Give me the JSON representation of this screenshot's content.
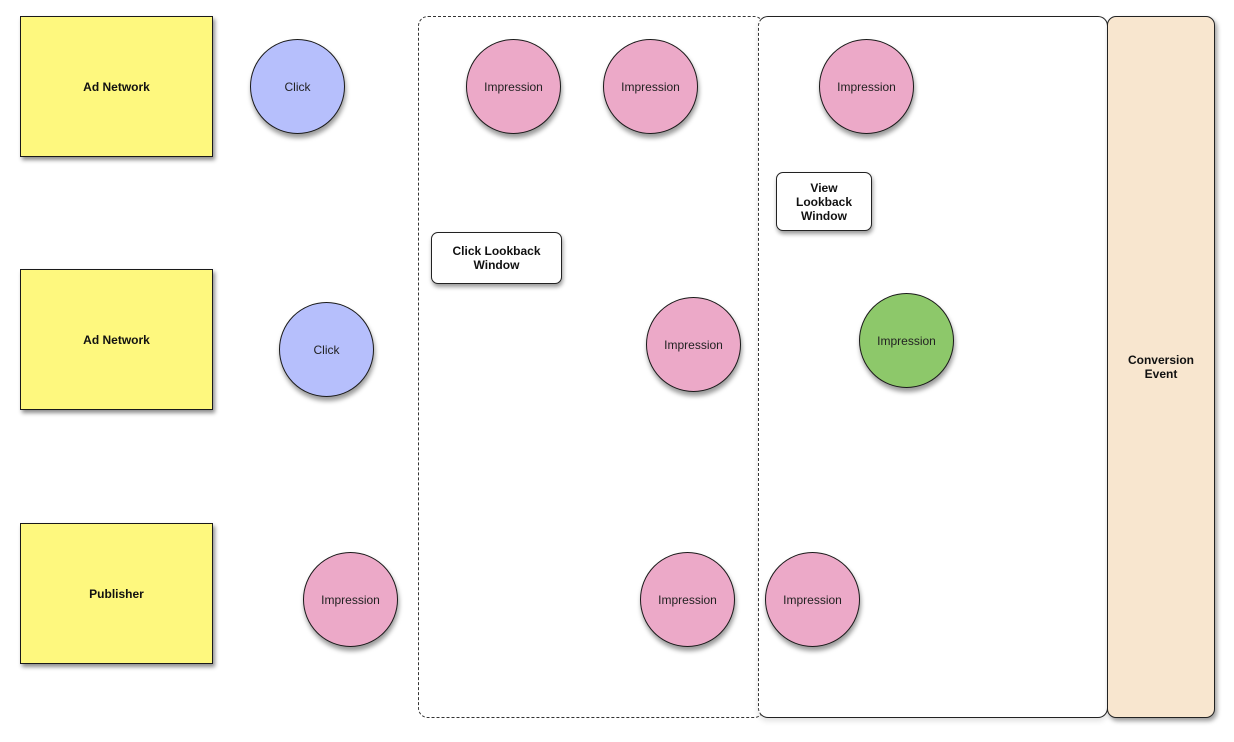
{
  "sources": [
    {
      "label": "Ad Network",
      "color": "#fef87e"
    },
    {
      "label": "Ad Network",
      "color": "#fef87e"
    },
    {
      "label": "Publisher",
      "color": "#fef87e"
    }
  ],
  "touchpoints": {
    "row1": [
      {
        "label": "Click",
        "type": "click"
      },
      {
        "label": "Impression",
        "type": "impression"
      },
      {
        "label": "Impression",
        "type": "impression"
      },
      {
        "label": "Impression",
        "type": "impression"
      }
    ],
    "row2": [
      {
        "label": "Click",
        "type": "click"
      },
      {
        "label": "Impression",
        "type": "impression"
      },
      {
        "label": "Impression",
        "type": "impression-attributed"
      }
    ],
    "row3": [
      {
        "label": "Impression",
        "type": "impression"
      },
      {
        "label": "Impression",
        "type": "impression"
      },
      {
        "label": "Impression",
        "type": "impression"
      }
    ]
  },
  "windows": {
    "click_lookback": "Click Lookback\nWindow",
    "view_lookback": "View\nLookback\nWindow"
  },
  "conversion": {
    "label": "Conversion\nEvent",
    "color": "#f8e6cf"
  },
  "colors": {
    "click": "#b6bffc",
    "impression": "#eca9c8",
    "impression_attributed": "#8dc86a"
  }
}
